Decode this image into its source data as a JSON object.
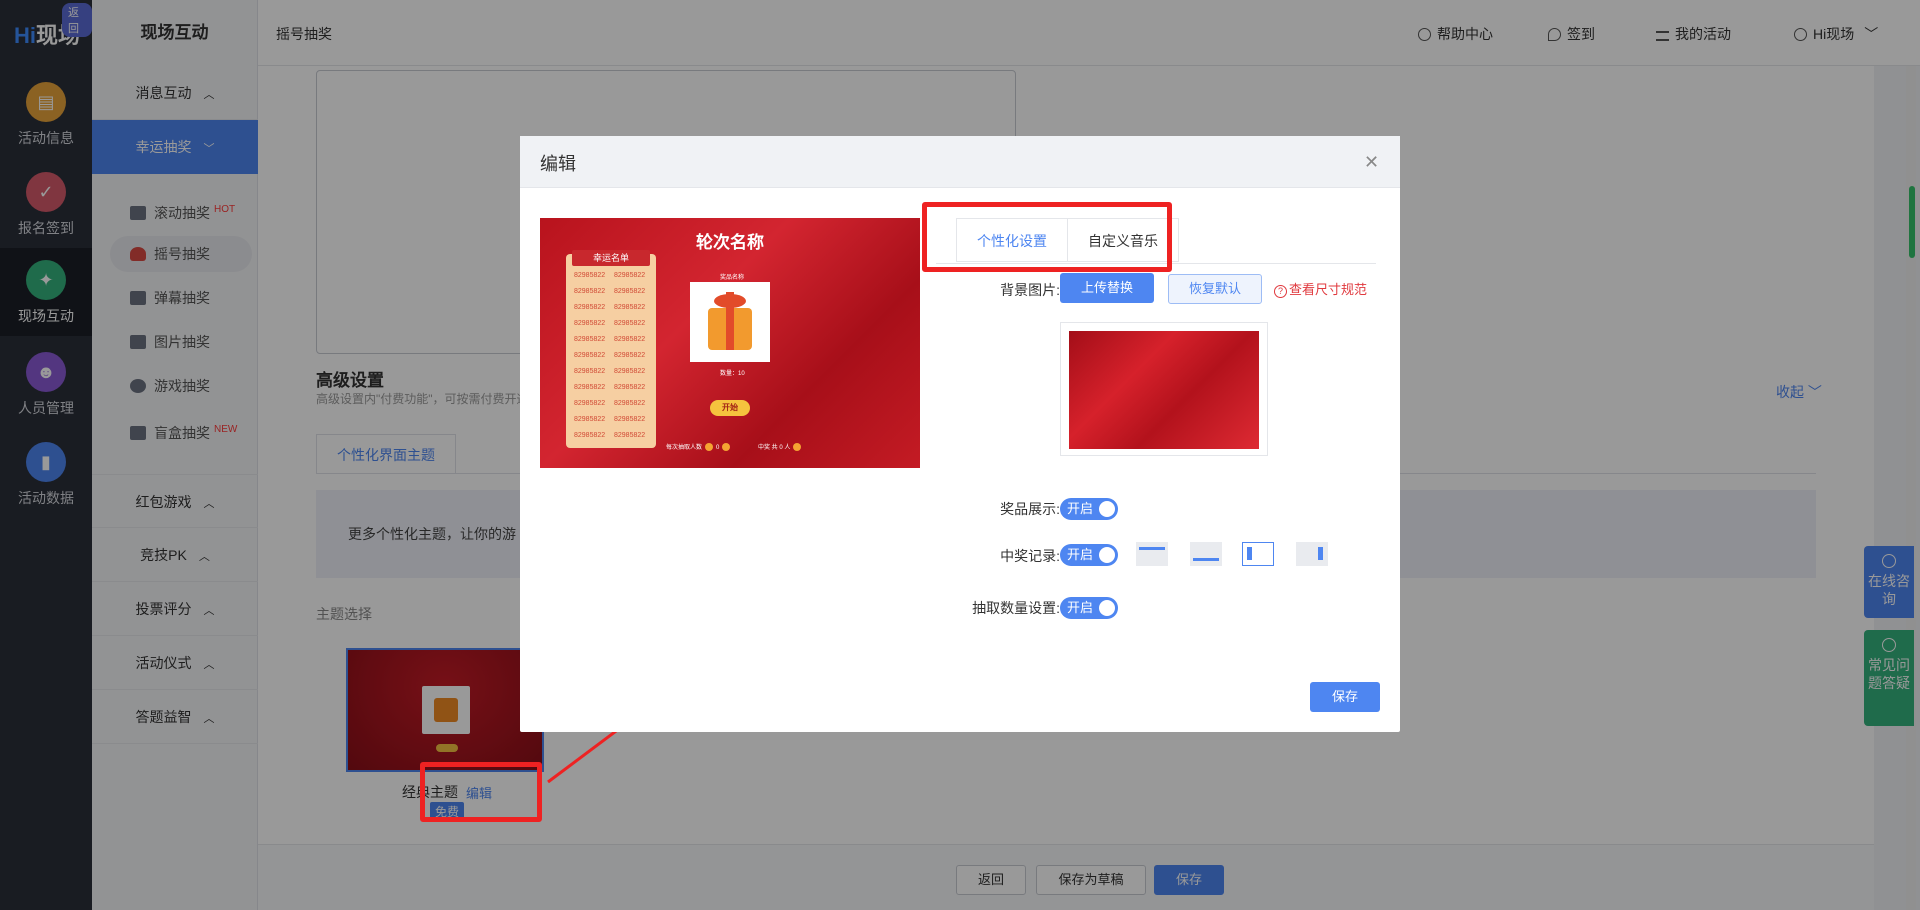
{
  "rail": {
    "back_badge": "返回",
    "logo_h": "Hi",
    "logo_text": "现场",
    "items": [
      {
        "label": "活动信息",
        "icon": "document-icon",
        "color": "#e8a33b"
      },
      {
        "label": "报名签到",
        "icon": "calendar-check-icon",
        "color": "#d65b6b"
      },
      {
        "label": "现场互动",
        "icon": "interact-icon",
        "color": "#35b37e"
      },
      {
        "label": "人员管理",
        "icon": "person-card-icon",
        "color": "#8a5bd6"
      },
      {
        "label": "活动数据",
        "icon": "bar-chart-icon",
        "color": "#4e86f1"
      }
    ]
  },
  "menu": {
    "title": "现场互动",
    "groups": [
      "消息互动",
      "幸运抽奖",
      "红包游戏",
      "竞技PK",
      "投票评分",
      "活动仪式",
      "答题益智"
    ],
    "subitems": [
      {
        "label": "滚动抽奖",
        "tag": "HOT"
      },
      {
        "label": "摇号抽奖",
        "tag": ""
      },
      {
        "label": "弹幕抽奖",
        "tag": ""
      },
      {
        "label": "图片抽奖",
        "tag": ""
      },
      {
        "label": "游戏抽奖",
        "tag": ""
      },
      {
        "label": "盲盒抽奖",
        "tag": "NEW"
      }
    ]
  },
  "header": {
    "crumb": "摇号抽奖",
    "help": "帮助中心",
    "signin": "签到",
    "my_activity": "我的活动",
    "user": "Hi现场"
  },
  "main": {
    "adv_title": "高级设置",
    "adv_sub": "高级设置内\"付费功能\"，可按需付费开通",
    "collapse": "收起",
    "theme_tab": "个性化界面主题",
    "banner": "更多个性化主题，让你的游",
    "theme_select": "主题选择",
    "theme_name": "经典主题",
    "theme_edit": "编辑",
    "free_badge": "免费"
  },
  "footer": {
    "back": "返回",
    "draft": "保存为草稿",
    "save": "保存"
  },
  "float": {
    "online": "在线咨询",
    "faq": "常见问题答疑"
  },
  "modal": {
    "title": "编辑",
    "preview": {
      "title": "轮次名称",
      "list_head": "幸运名单",
      "number": "82985822",
      "prize_name": "奖品名称",
      "qty": "数量：10",
      "start": "开始",
      "per_draw": "每次抽取人数",
      "per_draw_value": "0",
      "winners": "中奖 共 0 人"
    },
    "tabs": [
      "个性化设置",
      "自定义音乐"
    ],
    "bg_label": "背景图片:",
    "upload_btn": "上传替换",
    "reset_btn": "恢复默认",
    "size_link": "查看尺寸规范",
    "prize_label": "奖品展示:",
    "record_label": "中奖记录:",
    "count_label": "抽取数量设置:",
    "toggle_on": "开启",
    "save": "保存"
  }
}
